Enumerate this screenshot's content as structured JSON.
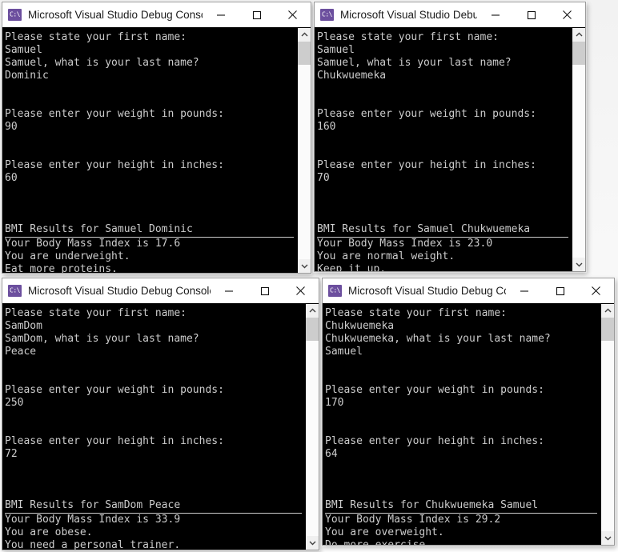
{
  "app": {
    "icon_glyph": "C:\\",
    "icon_color": "#6c4f9e",
    "console_bg": "#000000",
    "console_fg": "#cccccc",
    "titlebar_bg": "#ffffff",
    "titlebar_fg": "#1b1b1b",
    "desktop_bg": "#f2f2f2"
  },
  "controls": {
    "minimize_label": "Minimize",
    "maximize_label": "Maximize",
    "close_label": "Close"
  },
  "scrollbar": {
    "up_arrow_label": "Scroll up",
    "down_arrow_label": "Scroll down",
    "thumb_label": "Scroll thumb"
  },
  "windows": [
    {
      "id": "window-1",
      "title": "Microsoft Visual Studio Debug Console",
      "lines": [
        {
          "text": "Please state your first name:",
          "style": "normal"
        },
        {
          "text": "Samuel",
          "style": "normal"
        },
        {
          "text": "Samuel, what is your last name?",
          "style": "normal"
        },
        {
          "text": "Dominic",
          "style": "normal"
        },
        {
          "text": "",
          "style": "blank"
        },
        {
          "text": "",
          "style": "blank"
        },
        {
          "text": "Please enter your weight in pounds:",
          "style": "normal"
        },
        {
          "text": "90",
          "style": "normal"
        },
        {
          "text": "",
          "style": "blank"
        },
        {
          "text": "",
          "style": "blank"
        },
        {
          "text": "Please enter your height in inches:",
          "style": "normal"
        },
        {
          "text": "60",
          "style": "normal"
        },
        {
          "text": "",
          "style": "blank"
        },
        {
          "text": "",
          "style": "blank"
        },
        {
          "text": "",
          "style": "blank"
        },
        {
          "text": "BMI Results for Samuel Dominic",
          "style": "ruled"
        },
        {
          "text": "Your Body Mass Index is 17.6",
          "style": "normal"
        },
        {
          "text": "You are underweight.",
          "style": "normal"
        },
        {
          "text": "Eat more proteins.",
          "style": "normal"
        }
      ],
      "bmi": {
        "first_name": "Samuel",
        "last_name": "Dominic",
        "weight_lbs": "90",
        "height_in": "60",
        "index": "17.6",
        "category": "underweight",
        "advice": "Eat more proteins."
      }
    },
    {
      "id": "window-2",
      "title": "Microsoft Visual Studio Debug...",
      "lines": [
        {
          "text": "Please state your first name:",
          "style": "normal"
        },
        {
          "text": "Samuel",
          "style": "normal"
        },
        {
          "text": "Samuel, what is your last name?",
          "style": "normal"
        },
        {
          "text": "Chukwuemeka",
          "style": "normal"
        },
        {
          "text": "",
          "style": "blank"
        },
        {
          "text": "",
          "style": "blank"
        },
        {
          "text": "Please enter your weight in pounds:",
          "style": "normal"
        },
        {
          "text": "160",
          "style": "normal"
        },
        {
          "text": "",
          "style": "blank"
        },
        {
          "text": "",
          "style": "blank"
        },
        {
          "text": "Please enter your height in inches:",
          "style": "normal"
        },
        {
          "text": "70",
          "style": "normal"
        },
        {
          "text": "",
          "style": "blank"
        },
        {
          "text": "",
          "style": "blank"
        },
        {
          "text": "",
          "style": "blank"
        },
        {
          "text": "BMI Results for Samuel Chukwuemeka",
          "style": "ruled"
        },
        {
          "text": "Your Body Mass Index is 23.0",
          "style": "normal"
        },
        {
          "text": "You are normal weight.",
          "style": "normal"
        },
        {
          "text": "Keep it up.",
          "style": "normal"
        }
      ],
      "bmi": {
        "first_name": "Samuel",
        "last_name": "Chukwuemeka",
        "weight_lbs": "160",
        "height_in": "70",
        "index": "23.0",
        "category": "normal weight",
        "advice": "Keep it up."
      }
    },
    {
      "id": "window-3",
      "title": "Microsoft Visual Studio Debug Console",
      "lines": [
        {
          "text": "Please state your first name:",
          "style": "normal"
        },
        {
          "text": "SamDom",
          "style": "normal"
        },
        {
          "text": "SamDom, what is your last name?",
          "style": "normal"
        },
        {
          "text": "Peace",
          "style": "normal"
        },
        {
          "text": "",
          "style": "blank"
        },
        {
          "text": "",
          "style": "blank"
        },
        {
          "text": "Please enter your weight in pounds:",
          "style": "normal"
        },
        {
          "text": "250",
          "style": "normal"
        },
        {
          "text": "",
          "style": "blank"
        },
        {
          "text": "",
          "style": "blank"
        },
        {
          "text": "Please enter your height in inches:",
          "style": "normal"
        },
        {
          "text": "72",
          "style": "normal"
        },
        {
          "text": "",
          "style": "blank"
        },
        {
          "text": "",
          "style": "blank"
        },
        {
          "text": "",
          "style": "blank"
        },
        {
          "text": "BMI Results for SamDom Peace",
          "style": "ruled"
        },
        {
          "text": "Your Body Mass Index is 33.9",
          "style": "normal"
        },
        {
          "text": "You are obese.",
          "style": "normal"
        },
        {
          "text": "You need a personal trainer.",
          "style": "normal"
        }
      ],
      "bmi": {
        "first_name": "SamDom",
        "last_name": "Peace",
        "weight_lbs": "250",
        "height_in": "72",
        "index": "33.9",
        "category": "obese",
        "advice": "You need a personal trainer."
      }
    },
    {
      "id": "window-4",
      "title": "Microsoft Visual Studio Debug Co...",
      "lines": [
        {
          "text": "Please state your first name:",
          "style": "normal"
        },
        {
          "text": "Chukwuemeka",
          "style": "normal"
        },
        {
          "text": "Chukwuemeka, what is your last name?",
          "style": "normal"
        },
        {
          "text": "Samuel",
          "style": "normal"
        },
        {
          "text": "",
          "style": "blank"
        },
        {
          "text": "",
          "style": "blank"
        },
        {
          "text": "Please enter your weight in pounds:",
          "style": "normal"
        },
        {
          "text": "170",
          "style": "normal"
        },
        {
          "text": "",
          "style": "blank"
        },
        {
          "text": "",
          "style": "blank"
        },
        {
          "text": "Please enter your height in inches:",
          "style": "normal"
        },
        {
          "text": "64",
          "style": "normal"
        },
        {
          "text": "",
          "style": "blank"
        },
        {
          "text": "",
          "style": "blank"
        },
        {
          "text": "",
          "style": "blank"
        },
        {
          "text": "BMI Results for Chukwuemeka Samuel",
          "style": "ruled"
        },
        {
          "text": "Your Body Mass Index is 29.2",
          "style": "normal"
        },
        {
          "text": "You are overweight.",
          "style": "normal"
        },
        {
          "text": "Do more exercise.",
          "style": "normal"
        }
      ],
      "bmi": {
        "first_name": "Chukwuemeka",
        "last_name": "Samuel",
        "weight_lbs": "170",
        "height_in": "64",
        "index": "29.2",
        "category": "overweight",
        "advice": "Do more exercise."
      }
    }
  ]
}
